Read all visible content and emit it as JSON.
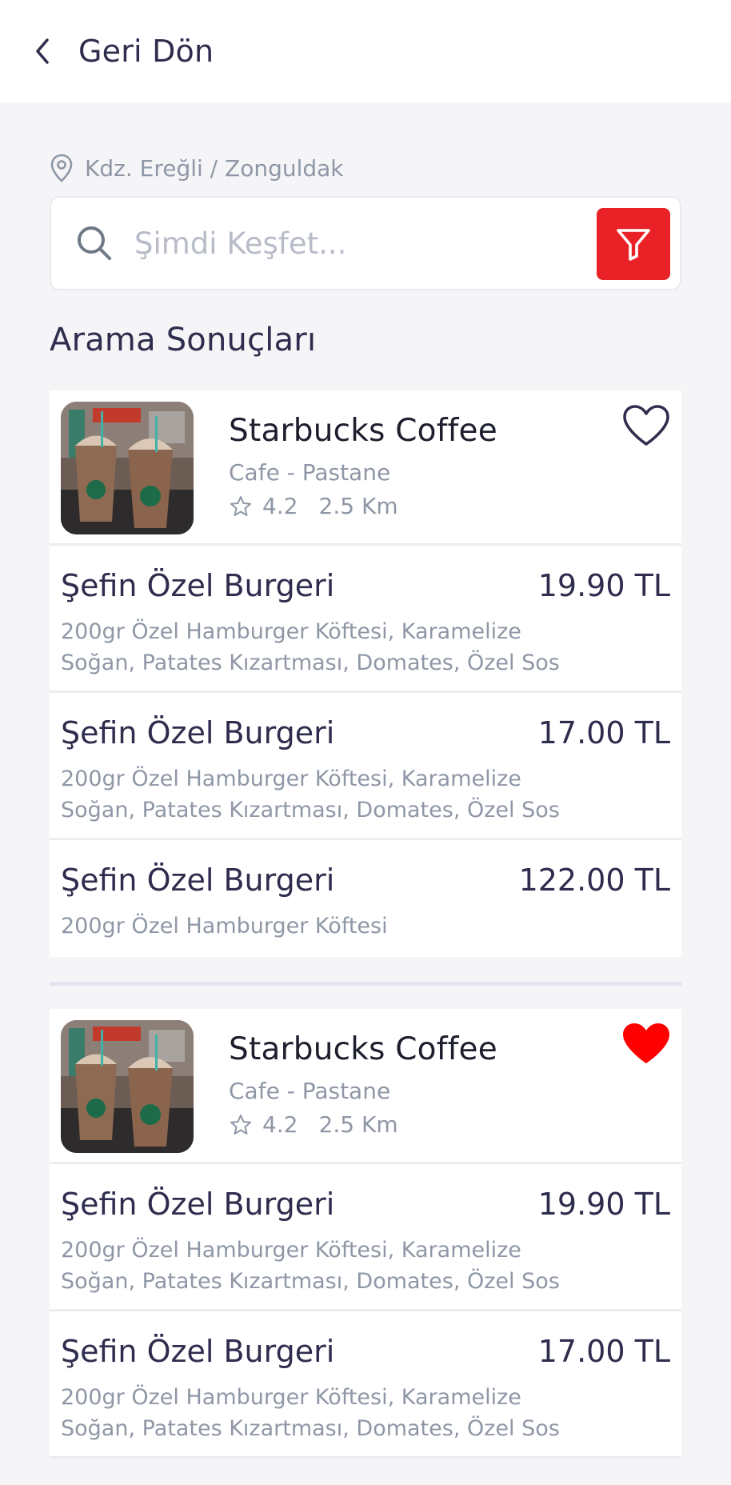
{
  "header": {
    "back_label": "Geri Dön"
  },
  "search": {
    "location": "Kdz. Ereğli / Zonguldak",
    "placeholder": "Şimdi Keşfet..."
  },
  "section_title": "Arama Sonuçları",
  "colors": {
    "accent": "#e92227",
    "text_dark": "#2e2d4d",
    "muted": "#8f97a6",
    "favorite": "#ff0000"
  },
  "results": [
    {
      "shop": {
        "name": "Starbucks Coffee",
        "category": "Cafe - Pastane",
        "rating": "4.2",
        "distance": "2.5 Km",
        "favorite": false,
        "favorite_icon": "heart-outline-icon"
      },
      "items": [
        {
          "name": "Şefin Özel Burgeri",
          "price": "19.90 TL",
          "desc_line1": "200gr Özel Hamburger Köftesi, Karamelize",
          "desc_line2": "Soğan, Patates Kızartması, Domates, Özel Sos"
        },
        {
          "name": "Şefin Özel Burgeri",
          "price": "17.00 TL",
          "desc_line1": "200gr Özel Hamburger Köftesi, Karamelize",
          "desc_line2": "Soğan, Patates Kızartması, Domates, Özel Sos"
        },
        {
          "name": "Şefin Özel Burgeri",
          "price": "122.00 TL",
          "desc_line1": "200gr Özel Hamburger Köftesi"
        }
      ]
    },
    {
      "shop": {
        "name": "Starbucks Coffee",
        "category": "Cafe - Pastane",
        "rating": "4.2",
        "distance": "2.5 Km",
        "favorite": true,
        "favorite_icon": "heart-filled-icon"
      },
      "items": [
        {
          "name": "Şefin Özel Burgeri",
          "price": "19.90 TL",
          "desc_line1": "200gr Özel Hamburger Köftesi, Karamelize",
          "desc_line2": "Soğan, Patates Kızartması, Domates, Özel Sos"
        },
        {
          "name": "Şefin Özel Burgeri",
          "price": "17.00 TL",
          "desc_line1": "200gr Özel Hamburger Köftesi, Karamelize",
          "desc_line2": "Soğan, Patates Kızartması, Domates, Özel Sos"
        }
      ]
    }
  ]
}
